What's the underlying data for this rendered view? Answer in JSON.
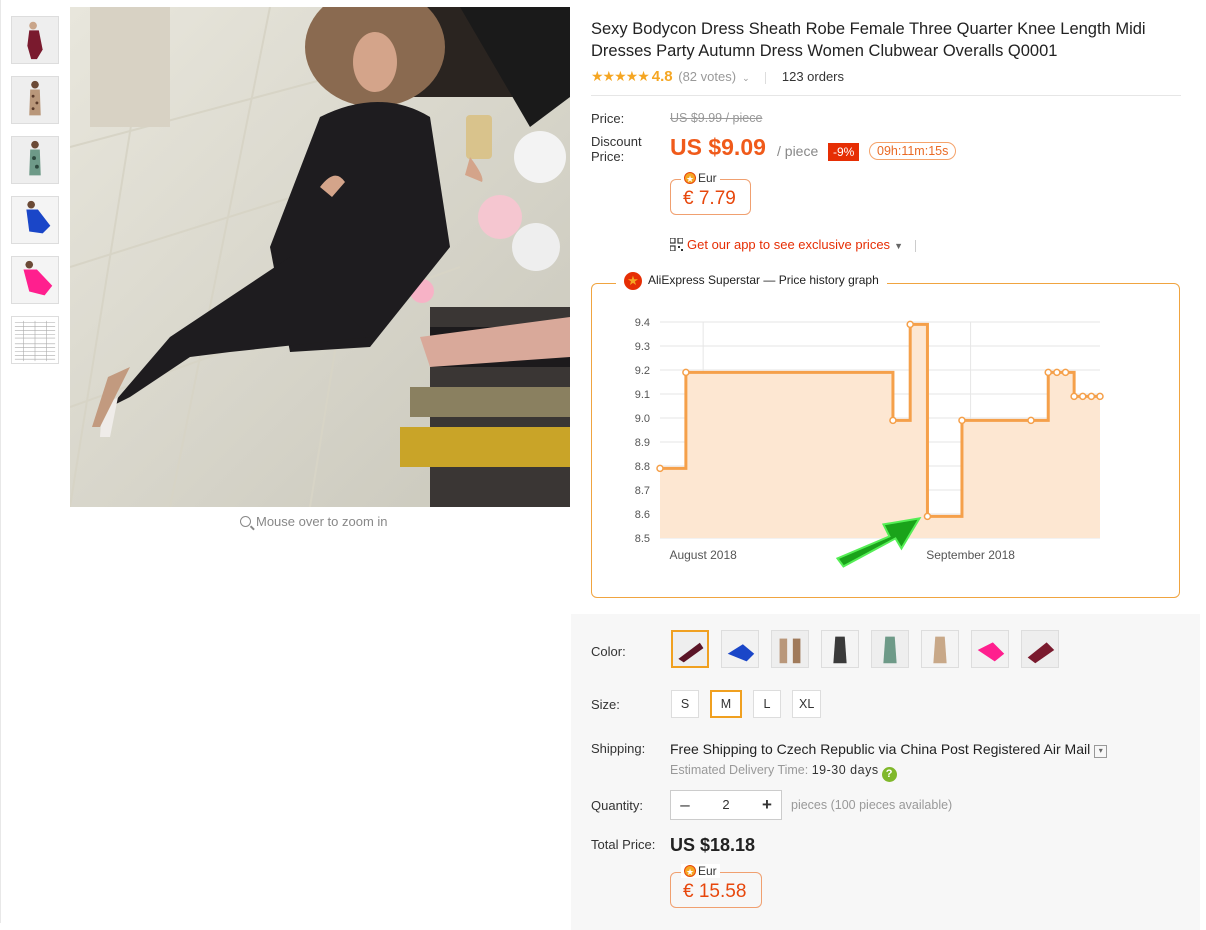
{
  "gallery": {
    "thumbnails": [
      "burgundy-dress",
      "leopard-dress",
      "green-print-dress",
      "blue-dress",
      "pink-dress",
      "size-chart"
    ],
    "zoom_hint": "Mouse over to zoom in"
  },
  "product": {
    "title": "Sexy Bodycon Dress Sheath Robe Female Three Quarter Knee Length Midi Dresses Party Autumn Dress Women Clubwear Overalls Q0001",
    "stars": "★★★★★",
    "rating": "4.8",
    "votes": "(82 votes)",
    "orders": "123 orders"
  },
  "pricing": {
    "price_label": "Price:",
    "original_price": "US $9.99 / piece",
    "discount_label_1": "Discount",
    "discount_label_2": "Price:",
    "discount_price": "US $9.09",
    "per_piece": "/ piece",
    "discount_badge": "-9%",
    "timer": "09h:11m:15s",
    "eur_label": "Eur",
    "eur_value": "€ 7.79",
    "app_link": "Get our app to see exclusive prices"
  },
  "graph": {
    "title": "AliExpress Superstar — Price history graph",
    "accent": "#f5a04a"
  },
  "chart_data": {
    "type": "line",
    "title": "AliExpress Superstar — Price history graph",
    "x_tick_labels": [
      "August 2018",
      "September 2018"
    ],
    "y_ticks": [
      8.5,
      8.6,
      8.7,
      8.8,
      8.9,
      9.0,
      9.1,
      9.2,
      9.3,
      9.4
    ],
    "ylim": [
      8.5,
      9.4
    ],
    "grid": true,
    "step": true,
    "series": [
      {
        "x": [
          "2018-07-27",
          "2018-07-30",
          "2018-08-23",
          "2018-08-25",
          "2018-08-27",
          "2018-08-31",
          "2018-09-08",
          "2018-09-10",
          "2018-09-11",
          "2018-09-12",
          "2018-09-13",
          "2018-09-14",
          "2018-09-15",
          "2018-09-16"
        ],
        "values": [
          8.79,
          9.19,
          8.99,
          9.39,
          8.59,
          8.99,
          8.99,
          9.19,
          9.19,
          9.19,
          9.09,
          9.09,
          9.09,
          9.09
        ]
      }
    ]
  },
  "options": {
    "color_label": "Color:",
    "colors": [
      "burgundy",
      "blue",
      "leopard",
      "grey",
      "green-print",
      "beige",
      "pink",
      "wine"
    ],
    "selected_color": 0,
    "size_label": "Size:",
    "sizes": [
      "S",
      "M",
      "L",
      "XL"
    ],
    "selected_size": 1
  },
  "shipping": {
    "label": "Shipping:",
    "text": "Free Shipping to Czech Republic via China Post Registered Air Mail",
    "delivery_label": "Estimated Delivery Time:",
    "delivery_days": "19-30 days"
  },
  "quantity": {
    "label": "Quantity:",
    "minus": "–",
    "value": "2",
    "plus": "+",
    "note": "pieces (100 pieces available)"
  },
  "total": {
    "label": "Total Price:",
    "value": "US $18.18",
    "eur_label": "Eur",
    "eur_value": "€ 15.58"
  }
}
